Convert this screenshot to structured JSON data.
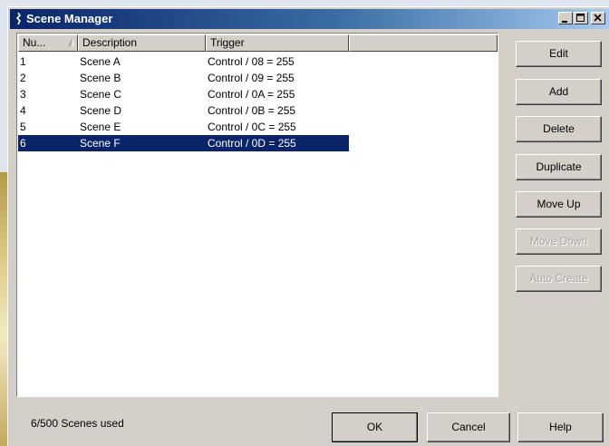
{
  "window": {
    "title": "Scene Manager",
    "controls": {
      "minimize": "minimize",
      "maximize": "maximize",
      "close": "close"
    }
  },
  "list": {
    "columns": [
      "Nu...",
      "Description",
      "Trigger",
      ""
    ],
    "rows": [
      {
        "num": "1",
        "description": "Scene A",
        "trigger": "Control / 08 = 255"
      },
      {
        "num": "2",
        "description": "Scene B",
        "trigger": "Control / 09 = 255"
      },
      {
        "num": "3",
        "description": "Scene C",
        "trigger": "Control / 0A = 255"
      },
      {
        "num": "4",
        "description": "Scene D",
        "trigger": "Control / 0B = 255"
      },
      {
        "num": "5",
        "description": "Scene E",
        "trigger": "Control / 0C = 255"
      },
      {
        "num": "6",
        "description": "Scene F",
        "trigger": "Control / 0D = 255"
      }
    ],
    "selected_row": 5
  },
  "side_buttons": {
    "edit": "Edit",
    "add": "Add",
    "delete": "Delete",
    "duplicate": "Duplicate",
    "move_up": "Move Up",
    "move_down": "Move Down",
    "auto_create": "Auto Create"
  },
  "status": {
    "scenes_used": "6/500 Scenes used"
  },
  "footer_buttons": {
    "ok": "OK",
    "cancel": "Cancel",
    "help": "Help"
  },
  "colors": {
    "title_start": "#0a246a",
    "selection": "#0a246a",
    "face": "#d4d0c8"
  }
}
